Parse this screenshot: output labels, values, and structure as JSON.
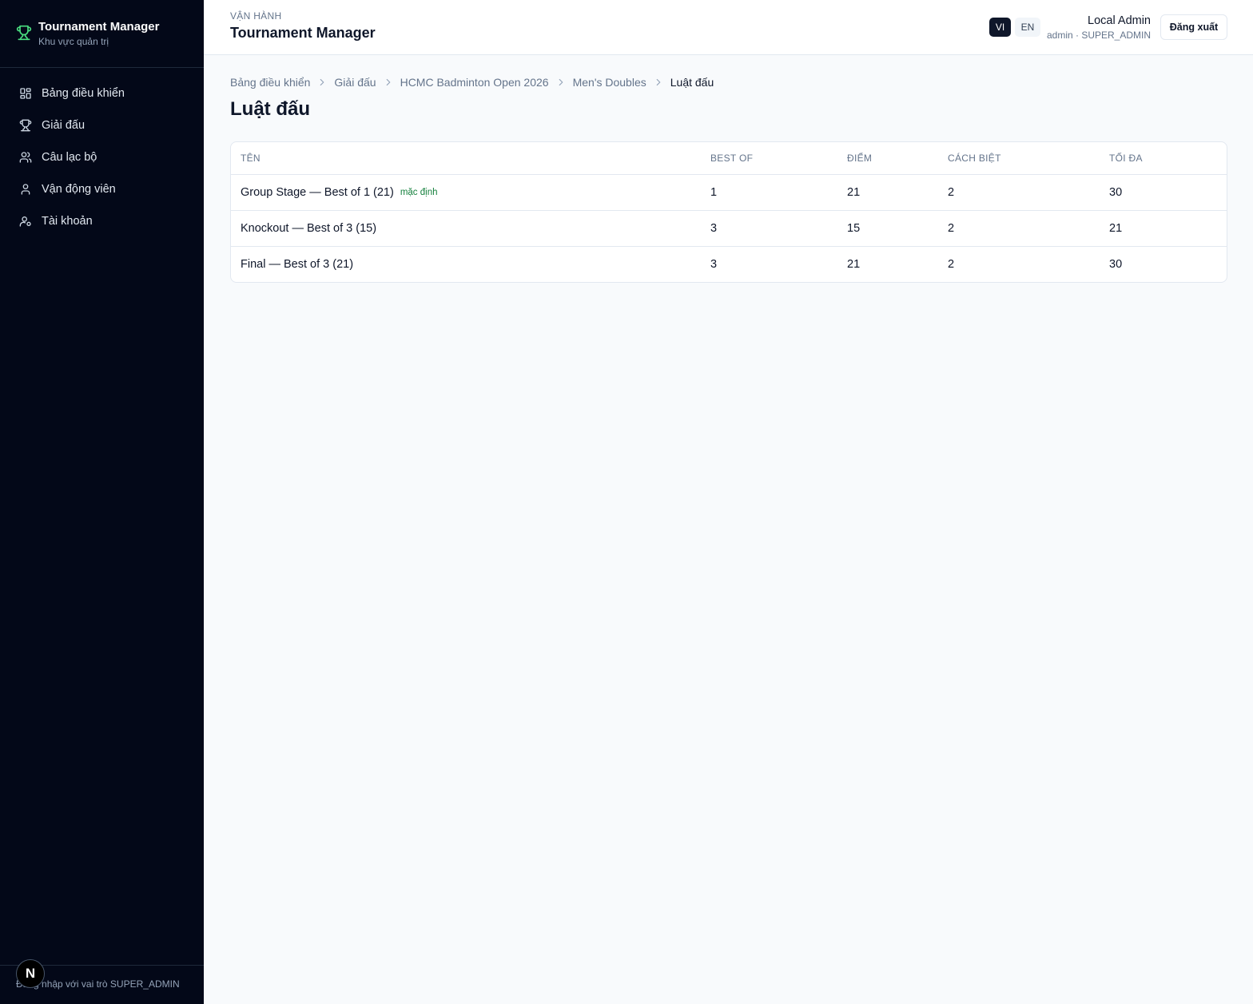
{
  "sidebar": {
    "brand_title": "Tournament Manager",
    "brand_subtitle": "Khu vực quản trị",
    "items": [
      {
        "label": "Bảng điều khiển",
        "icon": "dashboard-icon"
      },
      {
        "label": "Giải đấu",
        "icon": "trophy-icon"
      },
      {
        "label": "Câu lạc bộ",
        "icon": "users-icon"
      },
      {
        "label": "Vận động viên",
        "icon": "user-icon"
      },
      {
        "label": "Tài khoản",
        "icon": "user-cog-icon"
      }
    ],
    "footer": "Đăng nhập với vai trò SUPER_ADMIN",
    "badge": "N"
  },
  "header": {
    "kicker": "VẬN HÀNH",
    "title": "Tournament Manager",
    "lang_vi": "VI",
    "lang_en": "EN",
    "active_lang": "VI",
    "user_name": "Local Admin",
    "user_role": "admin · SUPER_ADMIN",
    "logout_label": "Đăng xuất"
  },
  "breadcrumb": [
    "Bảng điều khiển",
    "Giải đấu",
    "HCMC Badminton Open 2026",
    "Men's Doubles",
    "Luật đấu"
  ],
  "page_title": "Luật đấu",
  "table": {
    "columns": [
      "TÊN",
      "BEST OF",
      "ĐIỂM",
      "CÁCH BIỆT",
      "TỐI ĐA"
    ],
    "rows": [
      {
        "name": "Group Stage — Best of 1 (21)",
        "badge": "mặc định",
        "best_of": "1",
        "points": "21",
        "gap": "2",
        "max": "30"
      },
      {
        "name": "Knockout — Best of 3 (15)",
        "badge": "",
        "best_of": "3",
        "points": "15",
        "gap": "2",
        "max": "21"
      },
      {
        "name": "Final — Best of 3 (21)",
        "badge": "",
        "best_of": "3",
        "points": "21",
        "gap": "2",
        "max": "30"
      }
    ]
  },
  "colors": {
    "sidebar_bg": "#030818",
    "accent_green": "#4ade80",
    "badge_green": "#15803d",
    "page_bg": "#f8fafc"
  }
}
